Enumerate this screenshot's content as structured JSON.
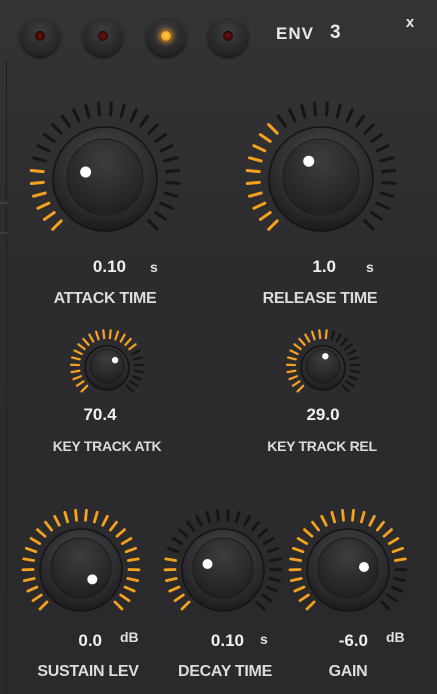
{
  "header": {
    "leds": [
      {
        "name": "led-1",
        "on": false
      },
      {
        "name": "led-2",
        "on": false
      },
      {
        "name": "led-3",
        "on": true
      },
      {
        "name": "led-4",
        "on": false
      }
    ],
    "env_label": "ENV",
    "env_number": "3",
    "close_label": "x"
  },
  "colors": {
    "accent": "#f6a21e",
    "inactive_tick": "#151517",
    "panel": "#2b2b2d"
  },
  "knobs": {
    "attack_time": {
      "value": "0.10",
      "unit": "s",
      "label": "ATTACK TIME",
      "fill": 0.22
    },
    "release_time": {
      "value": "1.0",
      "unit": "s",
      "label": "RELEASE TIME",
      "fill": 0.36
    },
    "key_track_atk": {
      "value": "70.4",
      "unit": "",
      "label": "KEY TRACK ATK",
      "fill": 0.7
    },
    "key_track_rel": {
      "value": "29.0",
      "unit": "",
      "label": "KEY TRACK REL",
      "fill": 0.55
    },
    "sustain_lev": {
      "value": "0.0",
      "unit": "dB",
      "label": "SUSTAIN LEV",
      "fill": 1.0
    },
    "decay_time": {
      "value": "0.10",
      "unit": "s",
      "label": "DECAY TIME",
      "fill": 0.22
    },
    "gain": {
      "value": "-6.0",
      "unit": "dB",
      "label": "GAIN",
      "fill": 0.82
    }
  }
}
